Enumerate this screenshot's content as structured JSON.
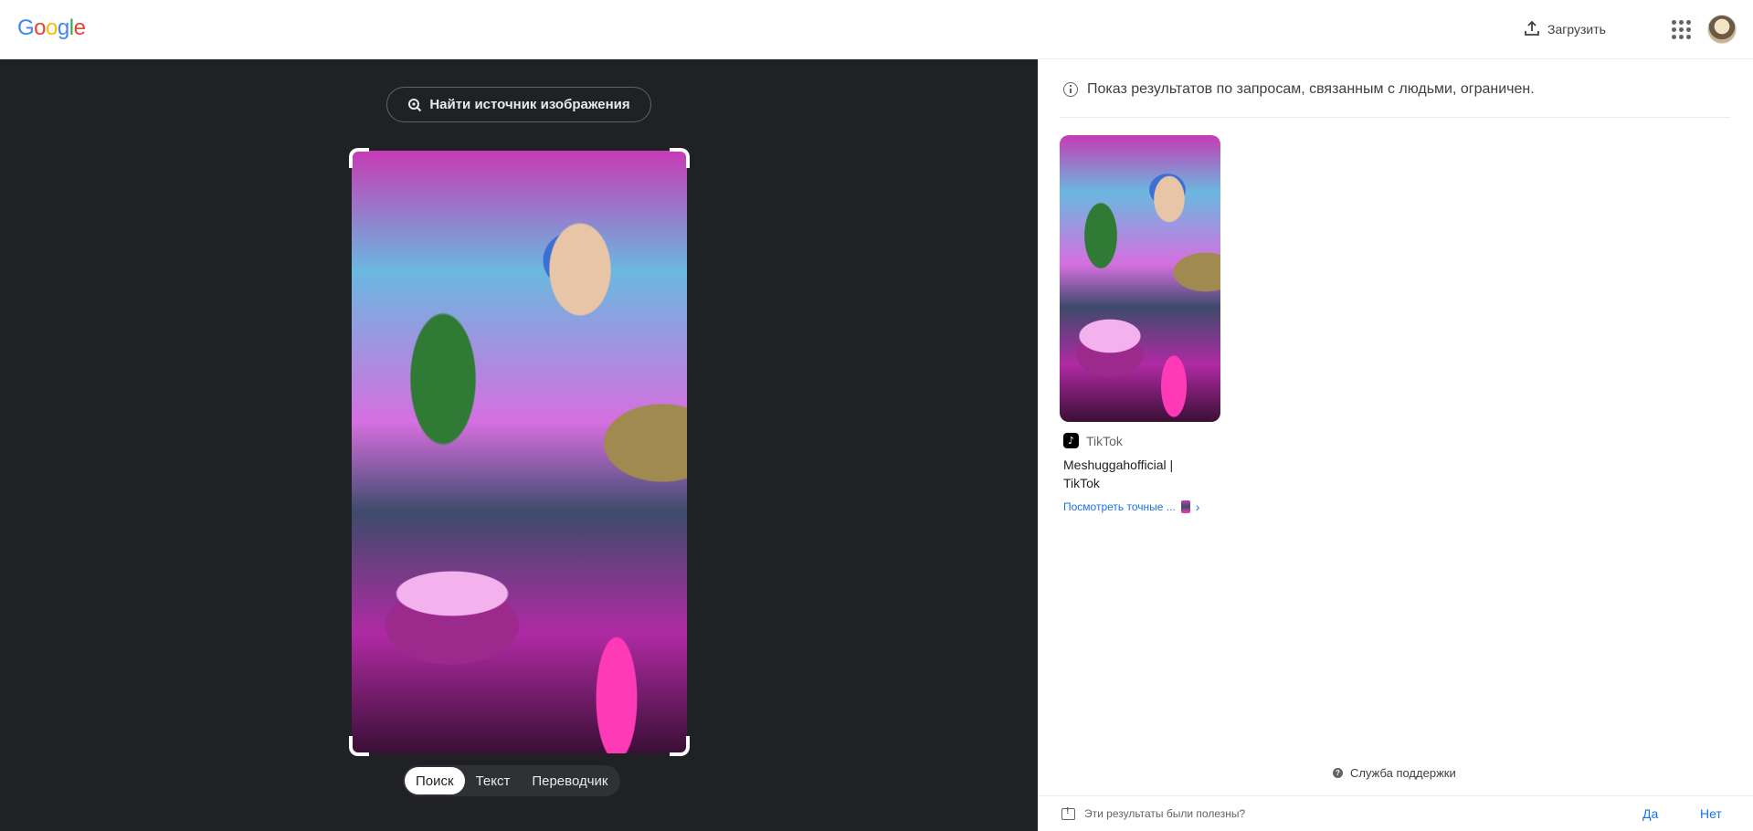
{
  "header": {
    "logo_letters": [
      {
        "ch": "G",
        "color": "#4285F4"
      },
      {
        "ch": "o",
        "color": "#EA4335"
      },
      {
        "ch": "o",
        "color": "#FBBC05"
      },
      {
        "ch": "g",
        "color": "#4285F4"
      },
      {
        "ch": "l",
        "color": "#34A853"
      },
      {
        "ch": "e",
        "color": "#EA4335"
      }
    ],
    "upload_label": "Загрузить"
  },
  "left": {
    "find_source_label": "Найти источник изображения",
    "tabs": [
      {
        "label": "Поиск",
        "active": true
      },
      {
        "label": "Текст",
        "active": false
      },
      {
        "label": "Переводчик",
        "active": false
      }
    ]
  },
  "right": {
    "notice": "Показ результатов по запросам, связанным с людьми, ограничен.",
    "result": {
      "source": "TikTok",
      "source_icon": "tiktok-icon",
      "title": "Meshuggahofficial | TikTok",
      "exact_link": "Посмотреть точные ..."
    },
    "support_label": "Служба поддержки",
    "feedback": {
      "question": "Эти результаты были полезны?",
      "yes": "Да",
      "no": "Нет"
    }
  },
  "colors": {
    "dark_bg": "#202124",
    "link_blue": "#1a73e8"
  }
}
